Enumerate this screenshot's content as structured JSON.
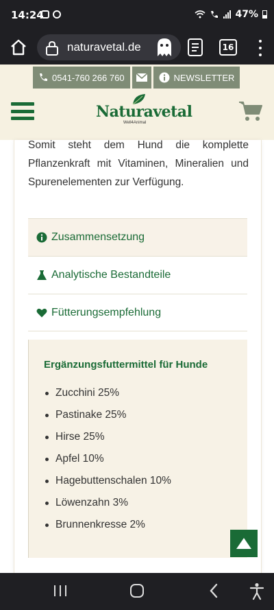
{
  "statusbar": {
    "time": "14:24",
    "battery": "47%"
  },
  "browser": {
    "url": "naturavetal.de",
    "tab_count": "16"
  },
  "header": {
    "phone": "0541-760 266 760",
    "newsletter": "NEWSLETTER",
    "logo_brand": "Naturavetal",
    "logo_tagline": "Well4Animal"
  },
  "content": {
    "intro": "Somit steht dem Hund die komplette Pflanzenkraft mit Vitaminen, Mineralien und Spurenelementen zur Verfügung.",
    "accordion": [
      {
        "label": "Zusammensetzung",
        "icon": "info-icon"
      },
      {
        "label": "Analytische Bestandteile",
        "icon": "flask-icon"
      },
      {
        "label": "Fütterungsempfehlung",
        "icon": "heart-icon"
      }
    ],
    "panel": {
      "title": "Ergänzungsfuttermittel für Hunde",
      "items": [
        "Zucchini 25%",
        "Pastinake 25%",
        "Hirse 25%",
        "Apfel 10%",
        "Hagebuttenschalen 10%",
        "Löwenzahn 3%",
        "Brunnenkresse 2%"
      ]
    }
  },
  "colors": {
    "brand_green": "#1a6b36",
    "contact_bar": "#7f8c76",
    "header_bg": "#f6f1e1",
    "panel_bg": "#f7f2e6"
  }
}
